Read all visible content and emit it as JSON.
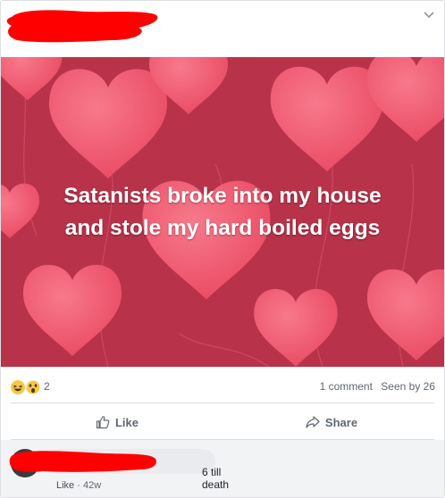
{
  "post": {
    "image_text_line1": "Satanists broke into my house",
    "image_text_line2": "and stole my hard boiled eggs",
    "reactions": [
      "laugh-emoji",
      "wow-emoji"
    ],
    "reaction_count": "2",
    "comment_count": "1 comment",
    "seen_by": "Seen by 26"
  },
  "actions": {
    "like_label": "Like",
    "share_label": "Share"
  },
  "comment": {
    "text": "6 till death",
    "like_label": "Like",
    "separator": "·",
    "time": "42w"
  },
  "colors": {
    "background_red": "#b8334a",
    "heart_pink": "#ef5c72",
    "redaction": "#ff0000"
  }
}
